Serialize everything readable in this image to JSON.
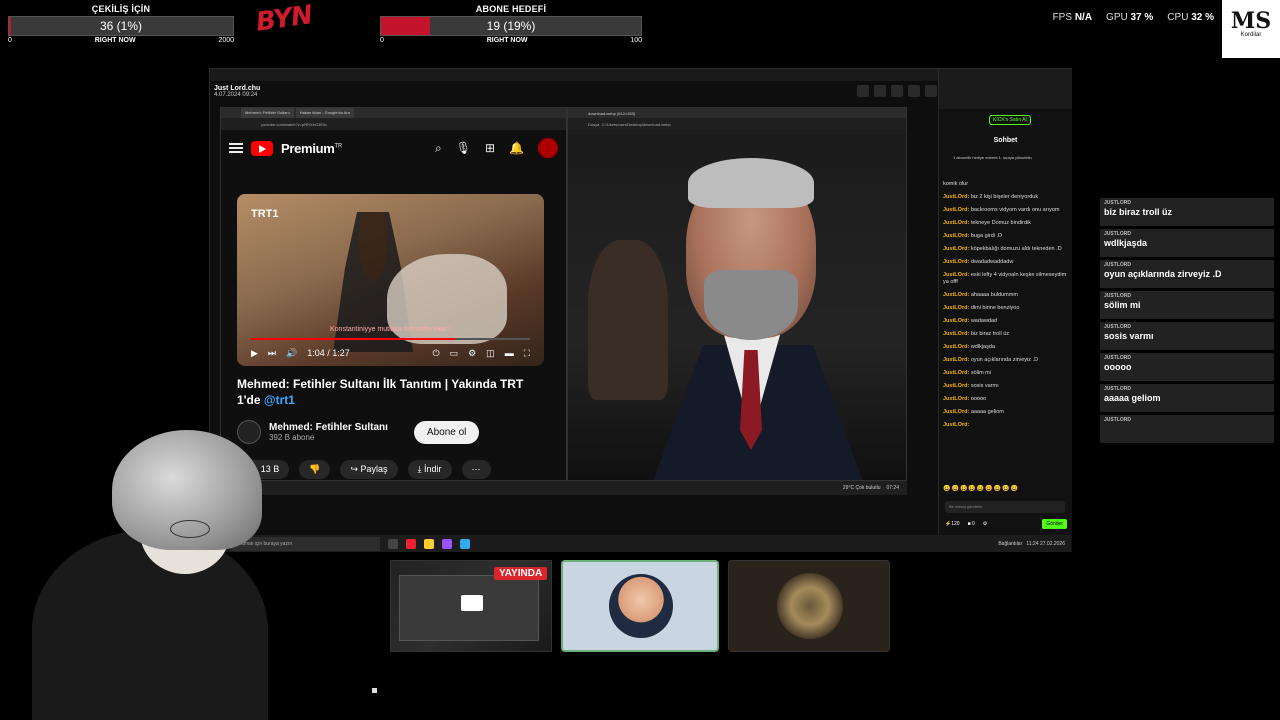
{
  "goal_giveaway": {
    "title": "ÇEKİLİŞ İÇİN",
    "value": "36 (1%)",
    "progress_percent": 1,
    "min": "0",
    "label": "RIGHT NOW",
    "max": "2000"
  },
  "goal_subscribers": {
    "title": "ABONE HEDEFİ",
    "value": "19 (19%)",
    "progress_percent": 19,
    "min": "0",
    "label": "RIGHT NOW",
    "max": "100"
  },
  "logo_byn_text": "BYN",
  "stats": {
    "fps_label": "FPS",
    "fps_value": "N/A",
    "gpu_label": "GPU",
    "gpu_value": "37 %",
    "cpu_label": "CPU",
    "cpu_value": "32 %"
  },
  "ms_logo": {
    "big": "MS",
    "small": "Kordilar"
  },
  "screen": {
    "user_name": "Just Lord.chu",
    "user_date": "4.07.2024 09:24"
  },
  "youtube": {
    "tabs": [
      "Mehmed: Fetihler Sultanı",
      "Hakan fidan - Google'da Ara"
    ],
    "url": "youtube.com/watch?v=pRRXeG3E9c",
    "brand": "Premium",
    "brand_sup": "TR",
    "video_badge": "TRT1",
    "caption": "Konstantiniyye mutlaka fethedilecektir !",
    "time": "1:04 / 1:27",
    "progress_percent": 73,
    "title": "Mehmed: Fetihler Sultanı İlk Tanıtım | Yakında TRT 1'de",
    "title_handle": "@trt1",
    "channel": "Mehmed: Fetihler Sultanı",
    "subs": "392 B abone",
    "subscribe": "Abone ol",
    "likes": "13 B",
    "share": "Paylaş",
    "download": "İndir"
  },
  "image_viewer": {
    "tab": "download.webp (612×353)",
    "url_label": "Dosya",
    "url": "C:/Users/user/Desktop/download.webp"
  },
  "inner_taskbar": {
    "weather": "29°C Çok bulutlu",
    "clock": "07:24"
  },
  "chat": {
    "kick_button": "KICK's Satın Al",
    "title": "Sohbet",
    "gift_notice": "1 abonelik hediye ederek 1. sıraya yükseldin",
    "lines": [
      {
        "user": "",
        "text": "komik olur"
      },
      {
        "user": "JustLOrd:",
        "text": "biz 2 kişi bişeler deniyorduk"
      },
      {
        "user": "JustLOrd:",
        "text": "backrooms vidyom vardı onu arıyom"
      },
      {
        "user": "JustLOrd:",
        "text": "tekneye Domuz bindirdik"
      },
      {
        "user": "JustLOrd:",
        "text": "buga girdi .D"
      },
      {
        "user": "JustLOrd:",
        "text": "köpekbalığı domuzu aldı tekneden .D"
      },
      {
        "user": "JustLOrd:",
        "text": "dwadadwaddadw"
      },
      {
        "user": "JustLOrd:",
        "text": "eski lefty 4 vidyoaln keşke silmeseydim ya offf"
      },
      {
        "user": "JustLOrd:",
        "text": "ahaaaa buldummm"
      },
      {
        "user": "JustLOrd:",
        "text": "dimi birine benziyoo"
      },
      {
        "user": "JustLOrd:",
        "text": "wadawdad"
      },
      {
        "user": "JustLOrd:",
        "text": "biz biraz troll üz"
      },
      {
        "user": "JustLOrd:",
        "text": "wdlkjaşda"
      },
      {
        "user": "JustLOrd:",
        "text": "oyun açıklarında zirveyiz .D"
      },
      {
        "user": "JustLOrd:",
        "text": "sölim mi"
      },
      {
        "user": "JustLOrd:",
        "text": "sosis varmı"
      },
      {
        "user": "JustLOrd:",
        "text": "ooooo"
      },
      {
        "user": "JustLOrd:",
        "text": "aaaaa geliom"
      },
      {
        "user": "JustLOrd:",
        "text": ""
      }
    ],
    "input_placeholder": "Bir mesaj gönderin",
    "points": "120",
    "count": "0",
    "send": "Gönder"
  },
  "taskbar": {
    "search_placeholder": "Aramak için buraya yazın",
    "tray_label": "Bağlantılar",
    "clock": "11:24",
    "date": "27.02.2026"
  },
  "overlay_chat": [
    {
      "user": "JUSTLORD",
      "text": "biz biraz troll üz"
    },
    {
      "user": "JUSTLORD",
      "text": "wdlkjaşda"
    },
    {
      "user": "JUSTLORD",
      "text": "oyun açıklarında zirveyiz .D"
    },
    {
      "user": "JUSTLORD",
      "text": "sölim mi"
    },
    {
      "user": "JUSTLORD",
      "text": "sosis varmı"
    },
    {
      "user": "JUSTLORD",
      "text": "ooooo"
    },
    {
      "user": "JUSTLORD",
      "text": "aaaaa geliom"
    },
    {
      "user": "JUSTLORD",
      "text": ""
    }
  ],
  "cams": {
    "live_badge": "YAYINDA"
  }
}
